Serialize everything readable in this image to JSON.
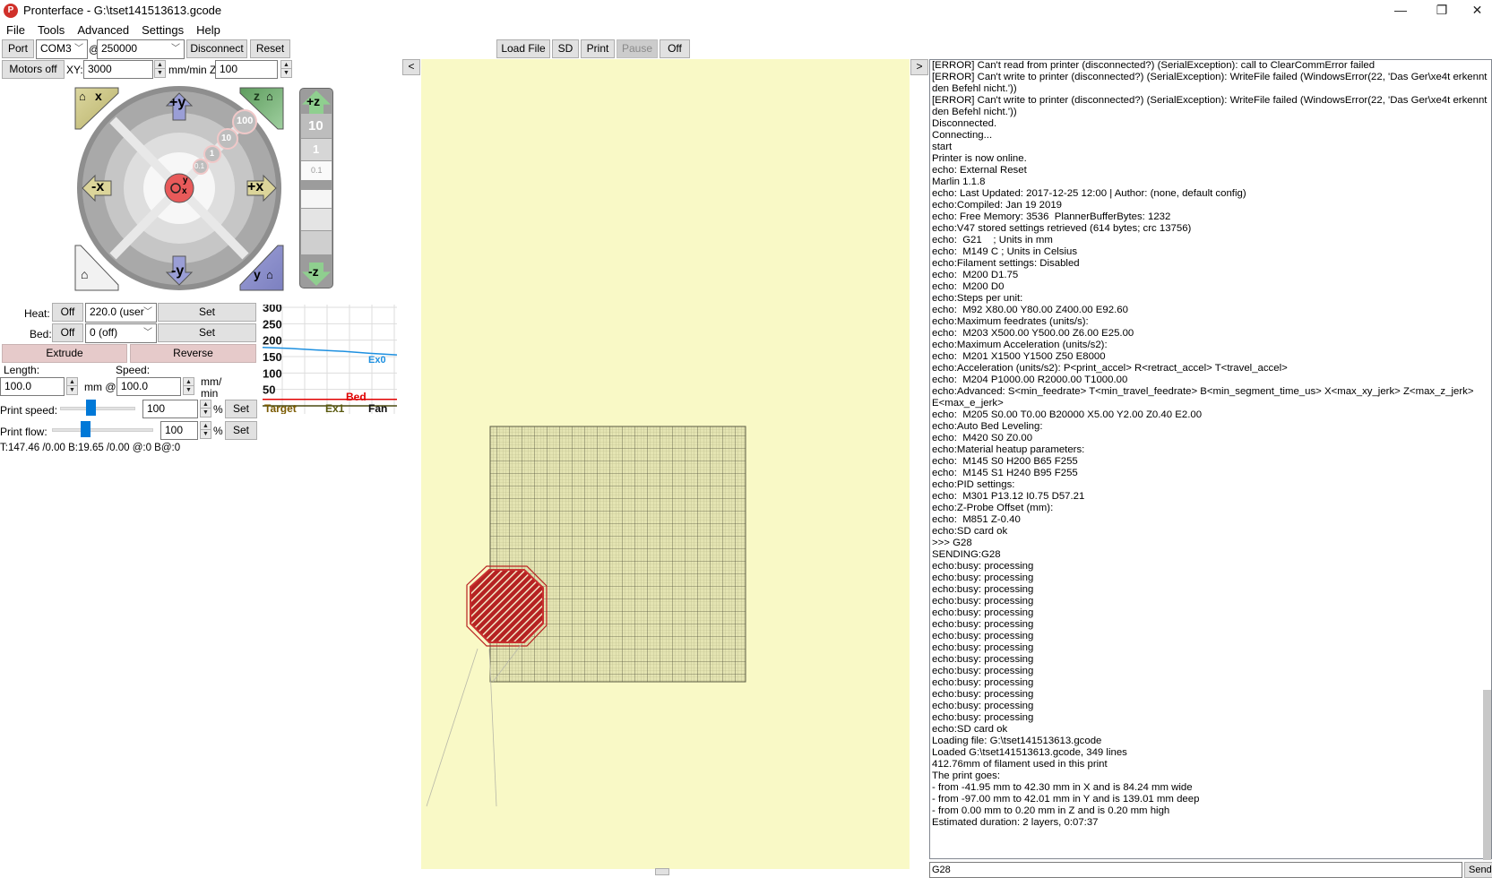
{
  "window": {
    "title": "Pronterface - G:\\tset141513613.gcode",
    "app_icon": "pronterface-logo-icon",
    "controls": {
      "minimize": "—",
      "maximize": "❐",
      "close": "✕"
    }
  },
  "menu": [
    "File",
    "Tools",
    "Advanced",
    "Settings",
    "Help"
  ],
  "connection": {
    "port_label": "Port",
    "port_value": "COM3",
    "at": "@",
    "baud_value": "250000",
    "disconnect_label": "Disconnect",
    "reset_label": "Reset"
  },
  "toolbar": {
    "load_file": "Load File",
    "sd": "SD",
    "print": "Print",
    "pause": "Pause",
    "off": "Off"
  },
  "motion": {
    "motors_off": "Motors off",
    "xy_label": "XY:",
    "xy_value": "3000",
    "units_label": "mm/min Z:",
    "z_value": "100"
  },
  "jog": {
    "home_x": "x",
    "home_z": "z",
    "home_y": "y",
    "plus_y": "+y",
    "minus_y": "-y",
    "plus_x": "+x",
    "minus_x": "-x",
    "steps": [
      "100",
      "10",
      "1",
      "0.1"
    ],
    "center_y": "y",
    "center_x": "x",
    "plus_z": "+z",
    "minus_z": "-z",
    "z_steps": [
      "10",
      "1",
      "0.1"
    ]
  },
  "temps": {
    "heat_label": "Heat:",
    "heat_off": "Off",
    "heat_value": "220.0 (user",
    "heat_set": "Set",
    "bed_label": "Bed:",
    "bed_off": "Off",
    "bed_value": "0 (off)",
    "bed_set": "Set"
  },
  "extrude": {
    "extrude_label": "Extrude",
    "reverse_label": "Reverse",
    "length_label": "Length:",
    "length_value": "100.0",
    "mm_at": "mm @",
    "speed_label": "Speed:",
    "speed_value": "100.0",
    "speed_units_1": "mm/",
    "speed_units_2": "min"
  },
  "print_speed": {
    "label": "Print speed:",
    "value": "100",
    "percent": "%",
    "set": "Set",
    "slider_fraction": 0.4
  },
  "print_flow": {
    "label": "Print flow:",
    "value": "100",
    "percent": "%",
    "set": "Set",
    "slider_fraction": 0.33
  },
  "status_line": "T:147.46 /0.00 B:19.65 /0.00 @:0 B@:0",
  "graph": {
    "y_ticks": [
      "300",
      "250",
      "200",
      "150",
      "100",
      "50"
    ],
    "legend": [
      "Target",
      "Ex1",
      "Fan"
    ],
    "series_labels": {
      "ex0": "Ex0",
      "bed": "Bed"
    },
    "colors": {
      "ex0": "#1e90e0",
      "bed": "#e00000",
      "target": "#cc8800",
      "grid": "#dddddd"
    }
  },
  "chart_data": {
    "type": "line",
    "title": "",
    "xlabel": "",
    "ylabel": "",
    "ylim": [
      0,
      300
    ],
    "y_ticks": [
      50,
      100,
      150,
      200,
      250,
      300
    ],
    "grid": true,
    "series": [
      {
        "name": "Ex0",
        "values": [
          178,
          175,
          170,
          166,
          160,
          155
        ]
      },
      {
        "name": "Bed",
        "values": [
          19.65,
          19.65,
          19.65,
          19.65,
          19.65,
          19.65
        ]
      },
      {
        "name": "Target",
        "values": [
          0,
          0,
          0,
          0,
          0,
          0
        ]
      }
    ],
    "legend": [
      "Target",
      "Ex1",
      "Fan"
    ]
  },
  "preview": {
    "collapse_left": "<",
    "collapse_right": ">",
    "bed_color": "#f9f9c6",
    "print_color": "#b82020"
  },
  "log": [
    "[ERROR] Can't read from printer (disconnected?) (SerialException): call to ClearCommError failed",
    "[ERROR] Can't write to printer (disconnected?) (SerialException): WriteFile failed (WindowsError(22, 'Das Ger\\xe4t erkennt den Befehl nicht.'))",
    "[ERROR] Can't write to printer (disconnected?) (SerialException): WriteFile failed (WindowsError(22, 'Das Ger\\xe4t erkennt den Befehl nicht.'))",
    "Disconnected.",
    "Connecting...",
    "start",
    "Printer is now online.",
    "echo: External Reset",
    "Marlin 1.1.8",
    "echo: Last Updated: 2017-12-25 12:00 | Author: (none, default config)",
    "echo:Compiled: Jan 19 2019",
    "echo: Free Memory: 3536  PlannerBufferBytes: 1232",
    "echo:V47 stored settings retrieved (614 bytes; crc 13756)",
    "echo:  G21    ; Units in mm",
    "echo:  M149 C ; Units in Celsius",
    "echo:Filament settings: Disabled",
    "echo:  M200 D1.75",
    "echo:  M200 D0",
    "echo:Steps per unit:",
    "echo:  M92 X80.00 Y80.00 Z400.00 E92.60",
    "echo:Maximum feedrates (units/s):",
    "echo:  M203 X500.00 Y500.00 Z6.00 E25.00",
    "echo:Maximum Acceleration (units/s2):",
    "echo:  M201 X1500 Y1500 Z50 E8000",
    "echo:Acceleration (units/s2): P<print_accel> R<retract_accel> T<travel_accel>",
    "echo:  M204 P1000.00 R2000.00 T1000.00",
    "echo:Advanced: S<min_feedrate> T<min_travel_feedrate> B<min_segment_time_us> X<max_xy_jerk> Z<max_z_jerk> E<max_e_jerk>",
    "echo:  M205 S0.00 T0.00 B20000 X5.00 Y2.00 Z0.40 E2.00",
    "echo:Auto Bed Leveling:",
    "echo:  M420 S0 Z0.00",
    "echo:Material heatup parameters:",
    "echo:  M145 S0 H200 B65 F255",
    "echo:  M145 S1 H240 B95 F255",
    "echo:PID settings:",
    "echo:  M301 P13.12 I0.75 D57.21",
    "echo:Z-Probe Offset (mm):",
    "echo:  M851 Z-0.40",
    "echo:SD card ok",
    ">>> G28",
    "SENDING:G28",
    "echo:busy: processing",
    "echo:busy: processing",
    "echo:busy: processing",
    "echo:busy: processing",
    "echo:busy: processing",
    "echo:busy: processing",
    "echo:busy: processing",
    "echo:busy: processing",
    "echo:busy: processing",
    "echo:busy: processing",
    "echo:busy: processing",
    "echo:busy: processing",
    "echo:busy: processing",
    "echo:busy: processing",
    "echo:SD card ok",
    "Loading file: G:\\tset141513613.gcode",
    "Loaded G:\\tset141513613.gcode, 349 lines",
    "412.76mm of filament used in this print",
    "The print goes:",
    "- from -41.95 mm to 42.30 mm in X and is 84.24 mm wide",
    "- from -97.00 mm to 42.01 mm in Y and is 139.01 mm deep",
    "- from 0.00 mm to 0.20 mm in Z and is 0.20 mm high",
    "Estimated duration: 2 layers, 0:07:37"
  ],
  "command": {
    "value": "G28",
    "send_label": "Send"
  }
}
